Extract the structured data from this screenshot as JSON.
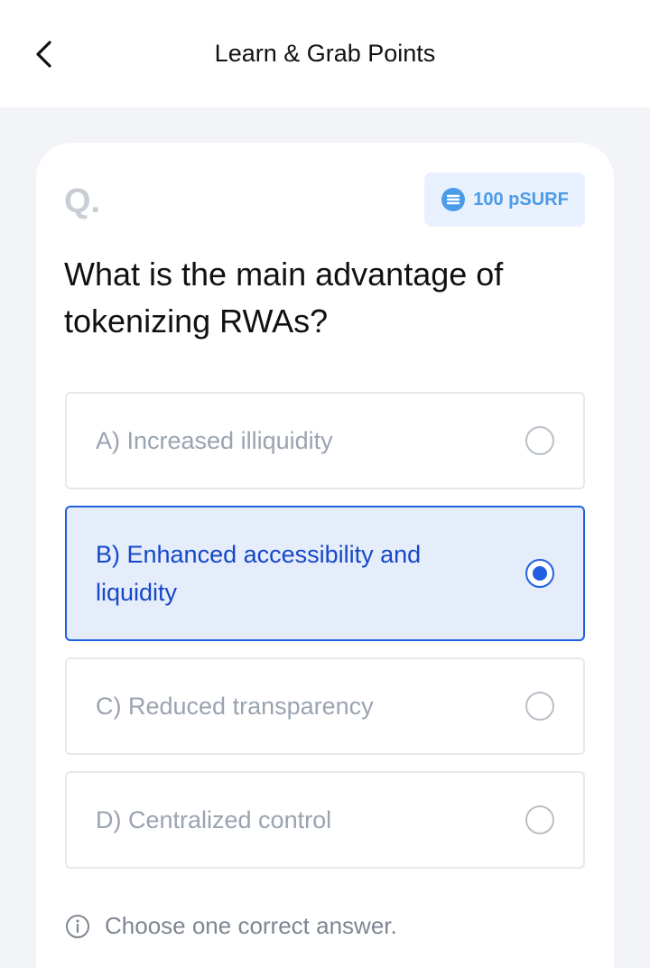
{
  "header": {
    "title": "Learn & Grab Points"
  },
  "quiz": {
    "q_marker": "Q.",
    "points": "100 pSURF",
    "question": "What is the main advantage of tokenizing RWAs?",
    "options": [
      {
        "label": "A) Increased illiquidity",
        "selected": false
      },
      {
        "label": "B) Enhanced accessibility and liquidity",
        "selected": true
      },
      {
        "label": "C) Reduced transparency",
        "selected": false
      },
      {
        "label": "D) Centralized control",
        "selected": false
      }
    ],
    "hint": "Choose one correct answer."
  },
  "icons": {
    "back": "chevron-left-icon",
    "points": "coin-icon",
    "hint": "info-icon"
  },
  "colors": {
    "accent": "#1f5fe0",
    "selected_bg": "#e5edfb",
    "badge_bg": "#e8f1fd",
    "badge_text": "#4a9be8"
  }
}
